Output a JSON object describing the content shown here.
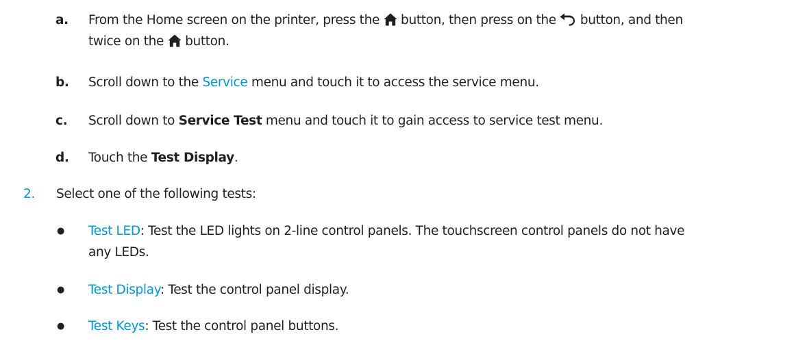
{
  "colors": {
    "accent": "#0096d6",
    "text": "#231f20"
  },
  "steps": {
    "a": {
      "marker": "a.",
      "text1": "From the Home screen on the printer, press the",
      "home_icon": "home-icon",
      "text2": "button, then press on the",
      "back_icon": "back-arrow-icon",
      "text3": "button, and then",
      "text4": "twice on the",
      "text5": "button."
    },
    "b": {
      "marker": "b.",
      "text1": "Scroll down to the",
      "link": "Service",
      "text2": "menu and touch it to access the service menu."
    },
    "c": {
      "marker": "c.",
      "text1": "Scroll down to",
      "bold": "Service Test",
      "text2": "menu and touch it to gain access to service test menu."
    },
    "d": {
      "marker": "d.",
      "text1": "Touch the",
      "bold": "Test Display",
      "text2": "."
    }
  },
  "step2": {
    "marker": "2.",
    "text": "Select one of the following tests:"
  },
  "tests": [
    {
      "bullet": "●",
      "name": "Test LED",
      "desc": ": Test the LED lights on 2-line control panels. The touchscreen control panels do not have",
      "desc_cont": "any LEDs."
    },
    {
      "bullet": "●",
      "name": "Test Display",
      "desc": ": Test the control panel display."
    },
    {
      "bullet": "●",
      "name": "Test Keys",
      "desc": ": Test the control panel buttons."
    }
  ]
}
